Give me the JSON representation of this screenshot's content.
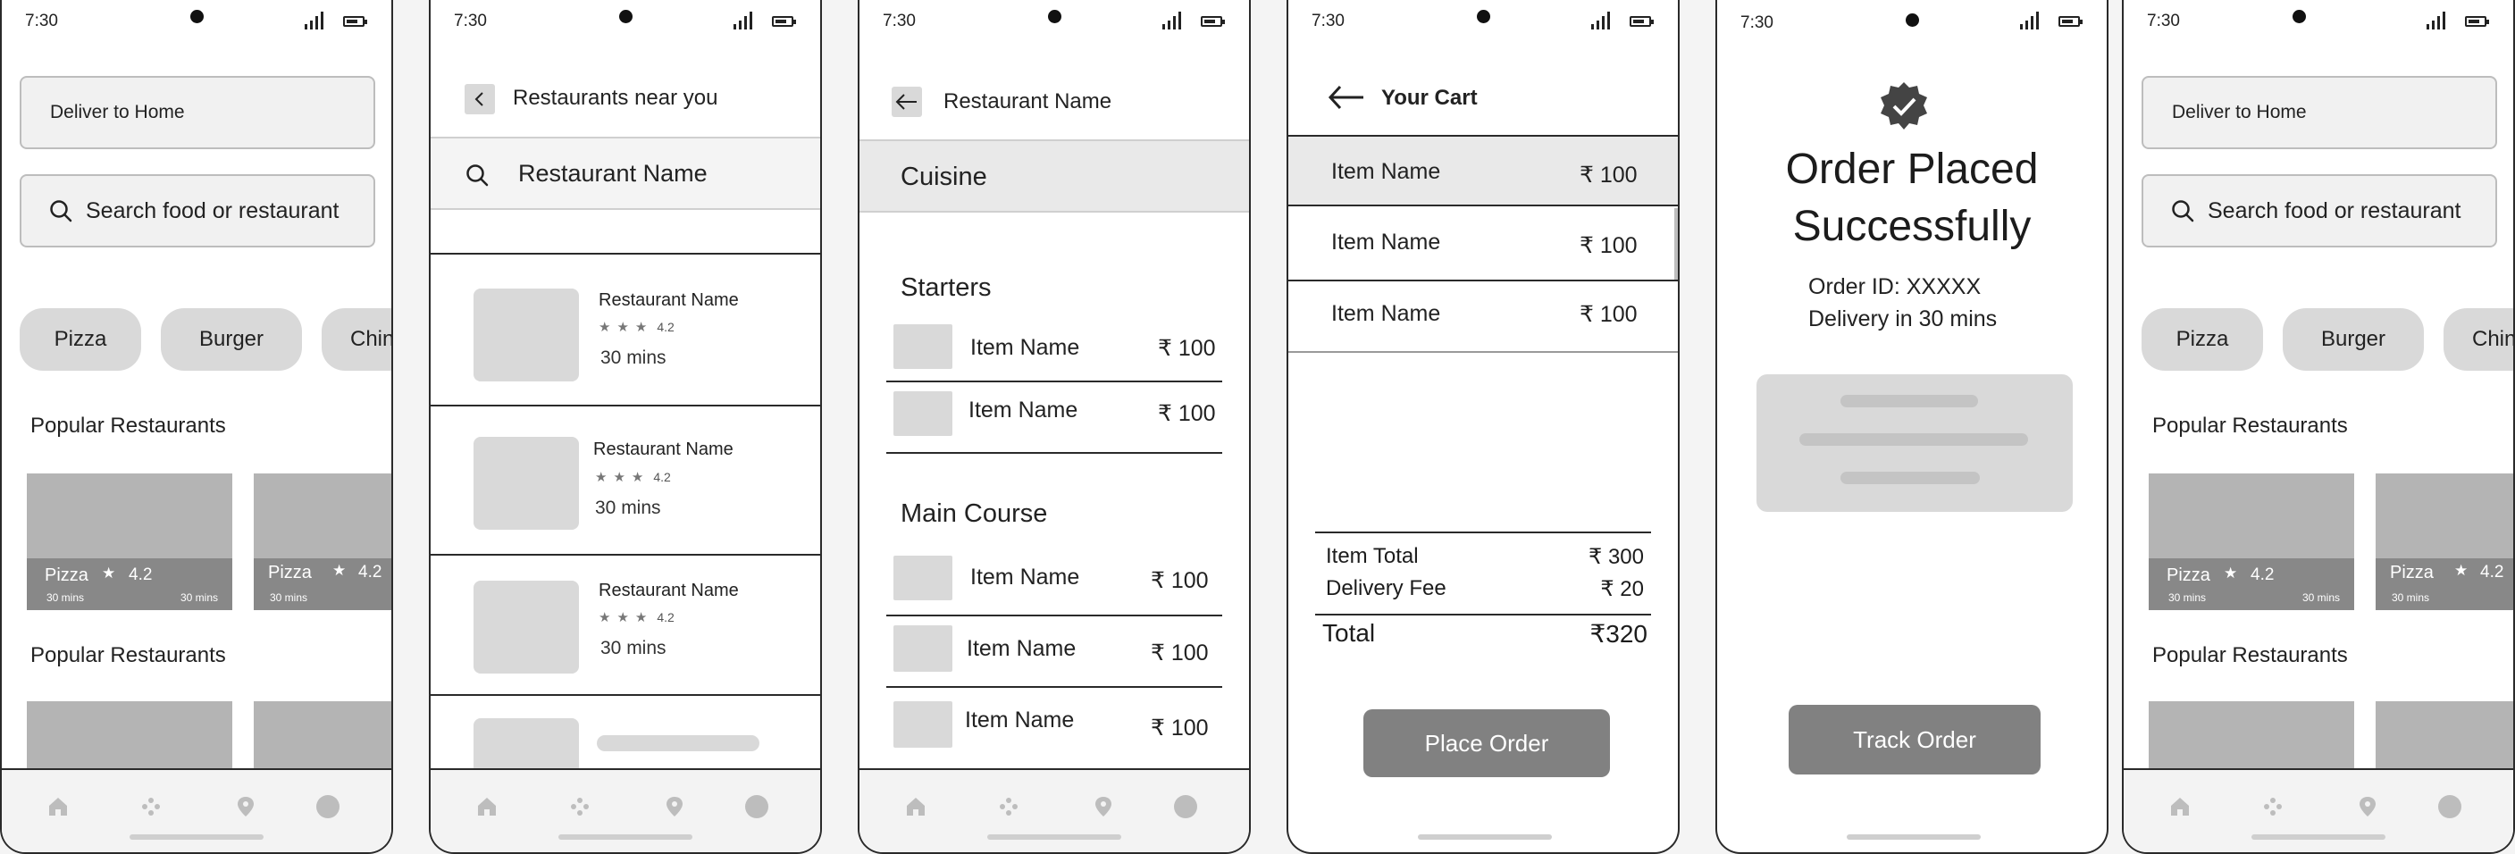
{
  "status": {
    "time": "7:30"
  },
  "home": {
    "deliver_to": "Deliver to Home",
    "search_placeholder": "Search food or restaurant",
    "chips": [
      "Pizza",
      "Burger",
      "Chin"
    ],
    "section1_title": "Popular Restaurants",
    "section2_title": "Popular Restaurants",
    "cards": [
      {
        "name": "Pizza",
        "rating": "4.2",
        "time_left": "30 mins",
        "time_right": "30 mins"
      },
      {
        "name": "Pizza",
        "rating": "4.2",
        "time_left": "30 mins",
        "time_right": ""
      }
    ]
  },
  "list": {
    "title": "Restaurants near you",
    "search_value": "Restaurant Name",
    "restaurants": [
      {
        "name": "Restaurant Name",
        "rating": "4.2",
        "time": "30 mins"
      },
      {
        "name": "Restaurant Name",
        "rating": "4.2",
        "time": "30 mins"
      },
      {
        "name": "Restaurant Name",
        "rating": "4.2",
        "time": "30 mins"
      }
    ]
  },
  "menu": {
    "title": "Restaurant Name",
    "cuisine": "Cuisine",
    "starters_title": "Starters",
    "main_title": "Main Course",
    "starters": [
      {
        "name": "Item Name",
        "price": "₹ 100"
      },
      {
        "name": "Item Name",
        "price": "₹ 100"
      }
    ],
    "main": [
      {
        "name": "Item Name",
        "price": "₹ 100"
      },
      {
        "name": "Item Name",
        "price": "₹ 100"
      },
      {
        "name": "Item Name",
        "price": "₹ 100"
      }
    ]
  },
  "cart": {
    "title": "Your Cart",
    "items": [
      {
        "name": "Item Name",
        "price": "₹ 100"
      },
      {
        "name": "Item Name",
        "price": "₹ 100"
      },
      {
        "name": "Item Name",
        "price": "₹ 100"
      }
    ],
    "item_total_label": "Item Total",
    "item_total_value": "₹ 300",
    "delivery_fee_label": "Delivery Fee",
    "delivery_fee_value": "₹ 20",
    "total_label": "Total",
    "total_value": "₹320",
    "place_order": "Place Order"
  },
  "success": {
    "title_line1": "Order Placed",
    "title_line2": "Successfully",
    "order_id": "Order ID: XXXXX",
    "delivery": "Delivery in 30 mins",
    "track_order": "Track Order"
  },
  "icons": {
    "nav": [
      "home-icon",
      "grid-icon",
      "location-pin-icon",
      "profile-icon"
    ],
    "search": "search-icon",
    "back": "back-arrow-icon",
    "verified": "verified-badge-icon"
  },
  "colors": {
    "button": "#818181",
    "placeholder": "#d9d9d9",
    "card": "#b4b4b4",
    "highlight": "#e9e9e9"
  }
}
